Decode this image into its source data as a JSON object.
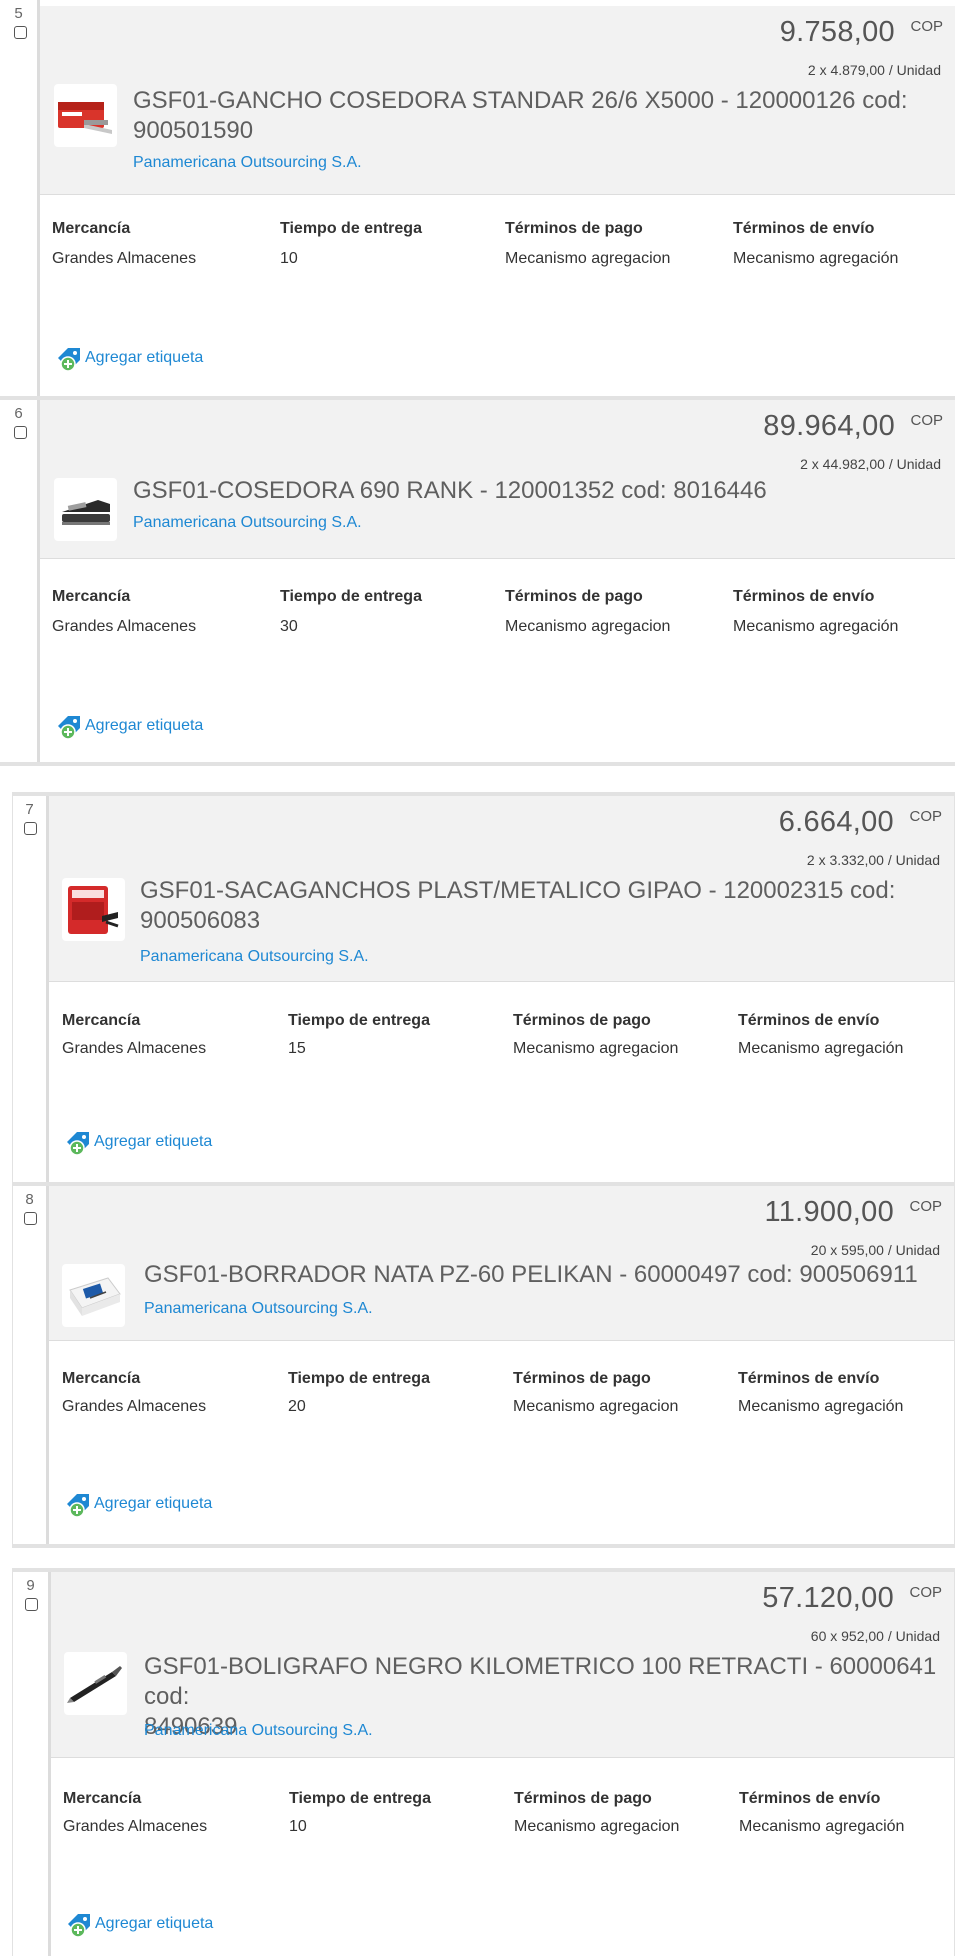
{
  "column_labels": {
    "merchandise": "Mercancía",
    "delivery": "Tiempo de entrega",
    "payment": "Términos de pago",
    "shipping": "Términos de envío"
  },
  "add_tag_label": "Agregar etiqueta",
  "currency": "COP",
  "items": [
    {
      "index": "5",
      "price": "9.758,00",
      "unit_price": "2 x 4.879,00 / Unidad",
      "title_line1": "GSF01-GANCHO COSEDORA STANDAR 26/6 X5000 - 120000126 cod:",
      "title_line2": "900501590",
      "supplier": "Panamericana Outsourcing S.A.",
      "merchandise": "Grandes Almacenes",
      "delivery": "10",
      "payment": "Mecanismo agregacion",
      "shipping": "Mecanismo agregación",
      "thumb_icon": "staples-box-icon"
    },
    {
      "index": "6",
      "price": "89.964,00",
      "unit_price": "2 x 44.982,00 / Unidad",
      "title_line1": "GSF01-COSEDORA 690 RANK - 120001352 cod: 8016446",
      "title_line2": "",
      "supplier": "Panamericana Outsourcing S.A.",
      "merchandise": "Grandes Almacenes",
      "delivery": "30",
      "payment": "Mecanismo agregacion",
      "shipping": "Mecanismo agregación",
      "thumb_icon": "stapler-icon"
    },
    {
      "index": "7",
      "price": "6.664,00",
      "unit_price": "2 x 3.332,00 / Unidad",
      "title_line1": "GSF01-SACAGANCHOS PLAST/METALICO GIPAO - 120002315 cod:",
      "title_line2": "900506083",
      "supplier": "Panamericana Outsourcing S.A.",
      "merchandise": "Grandes Almacenes",
      "delivery": "15",
      "payment": "Mecanismo agregacion",
      "shipping": "Mecanismo agregación",
      "thumb_icon": "staple-remover-box-icon"
    },
    {
      "index": "8",
      "price": "11.900,00",
      "unit_price": "20 x 595,00 / Unidad",
      "title_line1": "GSF01-BORRADOR NATA PZ-60 PELIKAN - 60000497 cod: 900506911",
      "title_line2": "",
      "supplier": "Panamericana Outsourcing S.A.",
      "merchandise": "Grandes Almacenes",
      "delivery": "20",
      "payment": "Mecanismo agregacion",
      "shipping": "Mecanismo agregación",
      "thumb_icon": "eraser-icon"
    },
    {
      "index": "9",
      "price": "57.120,00",
      "unit_price": "60 x 952,00 / Unidad",
      "title_line1": "GSF01-BOLIGRAFO NEGRO KILOMETRICO 100 RETRACTI - 60000641 cod:",
      "title_line2": "8490639",
      "supplier": "Panamericana Outsourcing S.A.",
      "merchandise": "Grandes Almacenes",
      "delivery": "10",
      "payment": "Mecanismo agregacion",
      "shipping": "Mecanismo agregación",
      "thumb_icon": "pen-icon"
    }
  ],
  "colors": {
    "accent_link": "#1e88d3",
    "header_bg": "#f2f2f2",
    "border": "#e2e2e2",
    "tag_icon": "#1e88d3",
    "tag_plus": "#5cb85c"
  }
}
